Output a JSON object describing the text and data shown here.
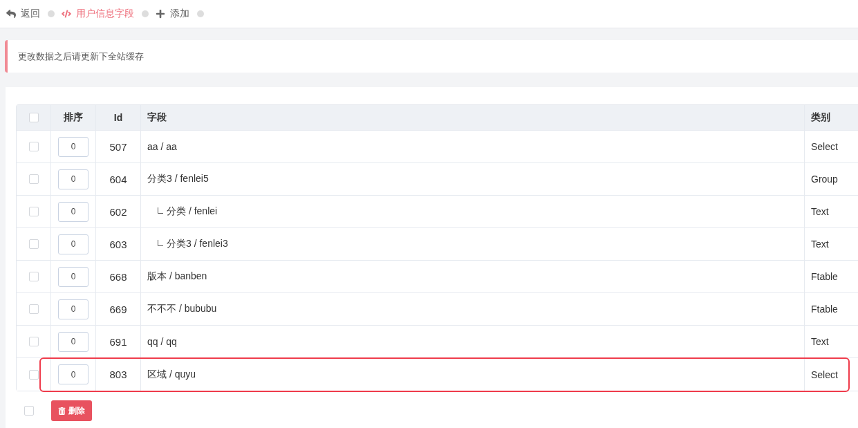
{
  "nav": [
    {
      "kind": "back",
      "label": "返回",
      "selected": false
    },
    {
      "kind": "page",
      "label": "用户信息字段",
      "selected": true
    },
    {
      "kind": "add",
      "label": "添加",
      "selected": false
    }
  ],
  "alert": {
    "text": "更改数据之后请更新下全站缓存"
  },
  "table": {
    "select_all": {
      "checked": false
    },
    "columns": [
      "排序",
      "Id",
      "字段",
      "类别"
    ],
    "rows": [
      {
        "checked": false,
        "sort": "0",
        "id": "507",
        "field": "aa / aa",
        "type": "Select",
        "highlighted": false
      },
      {
        "checked": false,
        "sort": "0",
        "id": "604",
        "field": "分类3 / fenlei5",
        "type": "Group",
        "highlighted": false,
        "children": [
          {
            "checked": false,
            "sort": "0",
            "id": "602",
            "field": "分类 / fenlei",
            "type": "Text",
            "highlighted": false
          },
          {
            "checked": false,
            "sort": "0",
            "id": "603",
            "field": "分类3 / fenlei3",
            "type": "Text",
            "highlighted": false
          }
        ]
      },
      {
        "checked": false,
        "sort": "0",
        "id": "668",
        "field": "版本 / banben",
        "type": "Ftable",
        "highlighted": false
      },
      {
        "checked": false,
        "sort": "0",
        "id": "669",
        "field": "不不不 / bububu",
        "type": "Ftable",
        "highlighted": false
      },
      {
        "checked": false,
        "sort": "0",
        "id": "691",
        "field": "qq / qq",
        "type": "Text",
        "highlighted": false
      },
      {
        "checked": false,
        "sort": "0",
        "id": "803",
        "field": "区域 / quyu",
        "type": "Select",
        "highlighted": true
      }
    ]
  },
  "footer": {
    "select_all": {
      "checked": false
    },
    "delete_button": "删除"
  }
}
